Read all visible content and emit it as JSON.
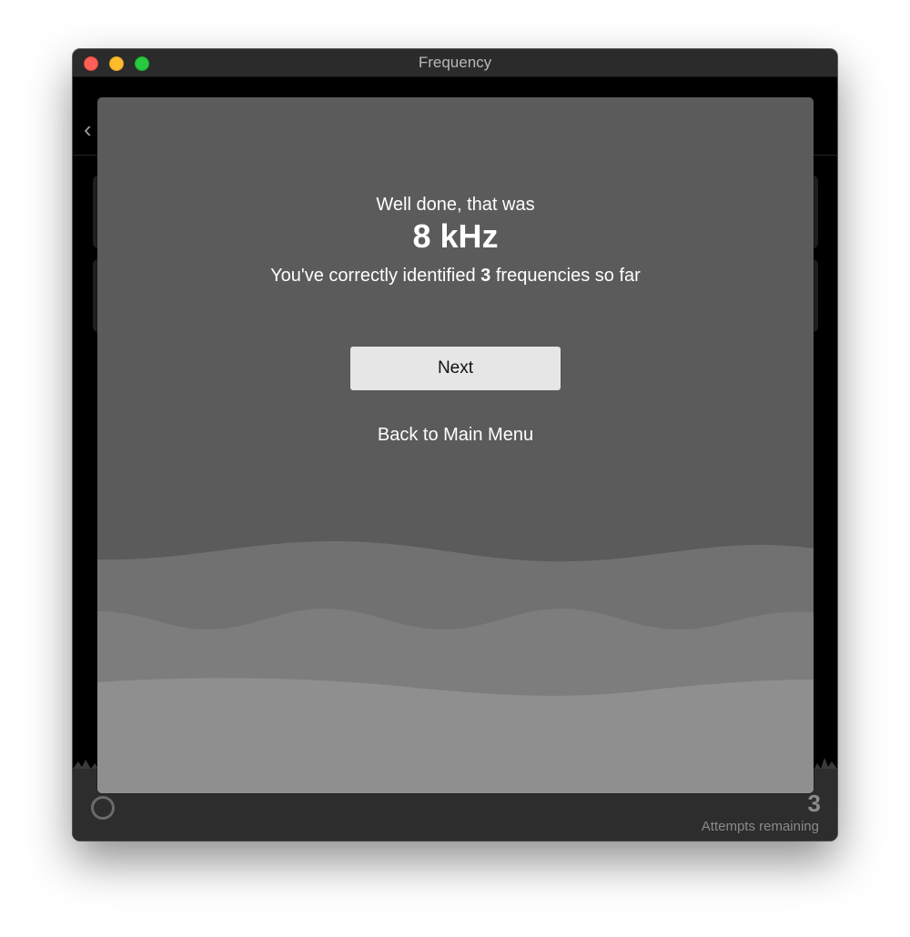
{
  "window": {
    "title": "Frequency"
  },
  "background": {
    "attempts_count": "3",
    "attempts_label": "Attempts remaining"
  },
  "dialog": {
    "line1": "Well done, that was",
    "frequency": "8 kHz",
    "score_prefix": "You've correctly identified ",
    "score_count": "3",
    "score_suffix": " frequencies so far",
    "next_label": "Next",
    "main_menu_label": "Back to Main Menu"
  },
  "icons": {
    "back": "chevron-left-icon",
    "restart": "restart-icon"
  },
  "colors": {
    "dialog_bg": "#5b5b5b",
    "wave_1": "#717171",
    "wave_2": "#7d7d7d",
    "wave_3": "#8f8f8f",
    "next_button_bg": "#e6e6e6",
    "close": "#fe5f57",
    "minimize": "#febc2e",
    "maximize": "#28c840"
  }
}
